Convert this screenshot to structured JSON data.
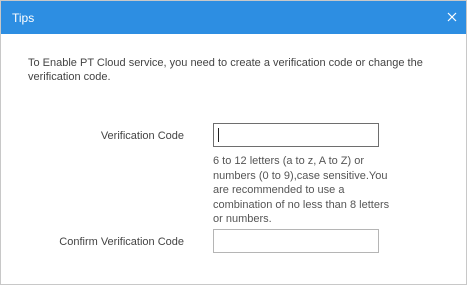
{
  "dialog": {
    "title": "Tips",
    "close_icon": "close-icon",
    "intro": "To Enable PT Cloud service, you need to create a verification code or change the verification code.",
    "fields": {
      "verification_code": {
        "label": "Verification Code",
        "value": "",
        "hint": "6 to 12 letters (a to z, A to Z) or numbers (0 to 9),case sensitive.You are recommended to use a combination of no less than 8 letters or numbers."
      },
      "confirm_code": {
        "label": "Confirm Verification Code",
        "value": ""
      }
    }
  },
  "colors": {
    "titlebar": "#2d8ee2",
    "title_text": "#ffffff",
    "body_text": "#444444"
  }
}
